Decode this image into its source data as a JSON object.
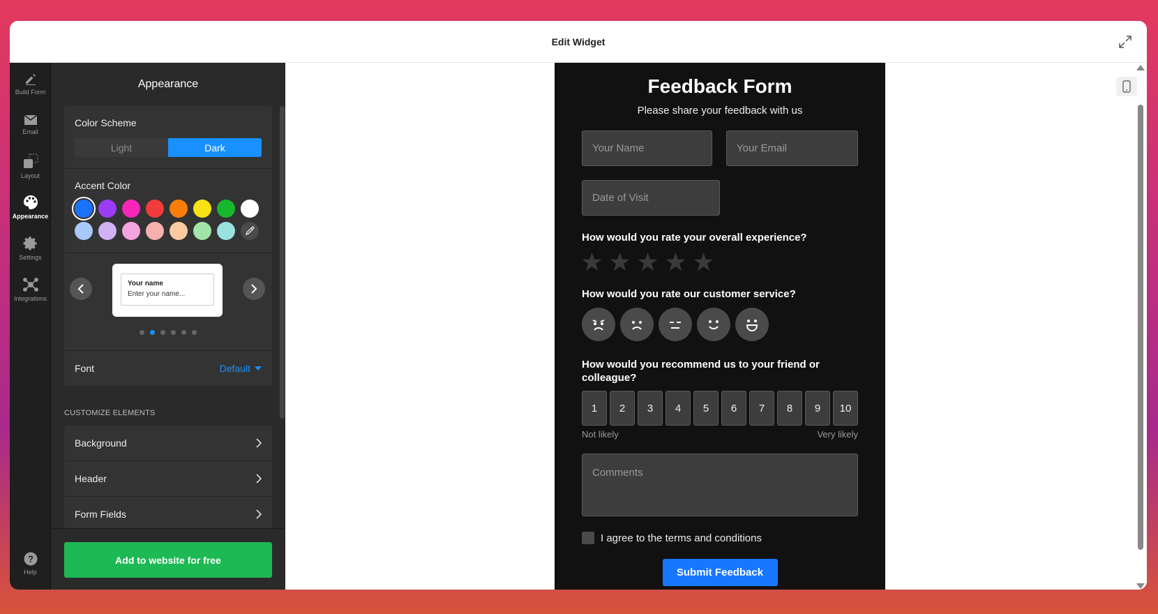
{
  "window": {
    "title": "Edit Widget"
  },
  "rail": {
    "items": [
      {
        "label": "Build Form",
        "icon": "pencil-icon"
      },
      {
        "label": "Email",
        "icon": "envelope-icon"
      },
      {
        "label": "Layout",
        "icon": "layout-icon"
      },
      {
        "label": "Appearance",
        "icon": "palette-icon",
        "active": true
      },
      {
        "label": "Settings",
        "icon": "gear-icon"
      },
      {
        "label": "Integrations",
        "icon": "integrations-icon"
      }
    ],
    "help_label": "Help"
  },
  "panel": {
    "title": "Appearance",
    "color_scheme": {
      "label": "Color Scheme",
      "options": [
        "Light",
        "Dark"
      ],
      "selected": "Dark"
    },
    "accent_color": {
      "label": "Accent Color",
      "colors_row1": [
        "#1a73ff",
        "#9b3cf5",
        "#f526b8",
        "#f23b3b",
        "#f87e0c",
        "#f7e314",
        "#17b82e",
        "#ffffff"
      ],
      "colors_row2": [
        "#a9c9fb",
        "#d1b2f5",
        "#f3a4df",
        "#f7b0b0",
        "#fbcaa0",
        "#a1e4a8",
        "#9ae2e0"
      ],
      "selected": "#1a73ff"
    },
    "preview": {
      "label": "Your name",
      "placeholder": "Enter your name..."
    },
    "font": {
      "label": "Font",
      "value": "Default"
    },
    "customize": {
      "label": "CUSTOMIZE ELEMENTS",
      "items": [
        "Background",
        "Header",
        "Form Fields"
      ]
    },
    "cta_label": "Add to website for free"
  },
  "form": {
    "title": "Feedback Form",
    "subtitle": "Please share your feedback with us",
    "name_placeholder": "Your Name",
    "email_placeholder": "Your Email",
    "date_placeholder": "Date of Visit",
    "q1": "How would you rate your overall experience?",
    "q2": "How would you rate our customer service?",
    "q3": "How would you recommend us to your friend or colleague?",
    "nps": [
      "1",
      "2",
      "3",
      "4",
      "5",
      "6",
      "7",
      "8",
      "9",
      "10"
    ],
    "nps_low": "Not likely",
    "nps_high": "Very likely",
    "comments_placeholder": "Comments",
    "agree": "I agree to the terms and conditions",
    "submit": "Submit Feedback"
  }
}
